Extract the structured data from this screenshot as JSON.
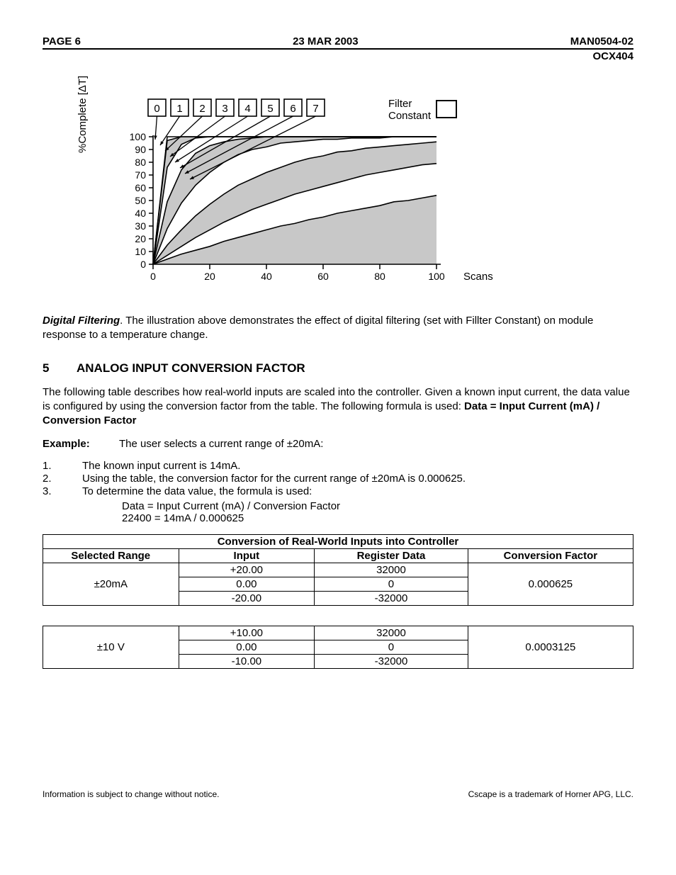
{
  "header": {
    "left": "PAGE 6",
    "center": "23 MAR 2003",
    "right": "MAN0504-02",
    "sub": "OCX404"
  },
  "chart_data": {
    "type": "line",
    "title": "",
    "xlabel": "Scans",
    "ylabel": "%Complete [ΔT]",
    "xlim": [
      0,
      100
    ],
    "ylim": [
      0,
      100
    ],
    "x_ticks": [
      0,
      20,
      40,
      60,
      80,
      100
    ],
    "y_ticks": [
      0,
      10,
      20,
      30,
      40,
      50,
      60,
      70,
      80,
      90,
      100
    ],
    "series_box_labels": [
      "0",
      "1",
      "2",
      "3",
      "4",
      "5",
      "6",
      "7"
    ],
    "legend_label": "Filter Constant",
    "x": [
      0,
      5,
      10,
      15,
      20,
      25,
      30,
      35,
      40,
      45,
      50,
      55,
      60,
      65,
      70,
      75,
      80,
      85,
      90,
      95,
      100
    ],
    "series": [
      {
        "name": "0",
        "values": [
          0,
          100,
          100,
          100,
          100,
          100,
          100,
          100,
          100,
          100,
          100,
          100,
          100,
          100,
          100,
          100,
          100,
          100,
          100,
          100,
          100
        ]
      },
      {
        "name": "1",
        "values": [
          0,
          97,
          100,
          100,
          100,
          100,
          100,
          100,
          100,
          100,
          100,
          100,
          100,
          100,
          100,
          100,
          100,
          100,
          100,
          100,
          100
        ]
      },
      {
        "name": "2",
        "values": [
          0,
          76,
          94,
          99,
          100,
          100,
          100,
          100,
          100,
          100,
          100,
          100,
          100,
          100,
          100,
          100,
          100,
          100,
          100,
          100,
          100
        ]
      },
      {
        "name": "3",
        "values": [
          0,
          49,
          74,
          87,
          93,
          96,
          98,
          99,
          100,
          100,
          100,
          100,
          100,
          100,
          100,
          100,
          100,
          100,
          100,
          100,
          100
        ]
      },
      {
        "name": "4",
        "values": [
          0,
          28,
          48,
          62,
          72,
          80,
          86,
          90,
          92,
          95,
          96,
          97,
          98,
          98,
          99,
          99,
          99,
          100,
          100,
          100,
          100
        ]
      },
      {
        "name": "5",
        "values": [
          0,
          15,
          27,
          38,
          47,
          55,
          62,
          67,
          72,
          76,
          80,
          83,
          85,
          88,
          89,
          91,
          92,
          93,
          94,
          95,
          96
        ]
      },
      {
        "name": "6",
        "values": [
          0,
          7,
          14,
          21,
          27,
          33,
          38,
          43,
          47,
          51,
          55,
          58,
          61,
          64,
          67,
          70,
          72,
          74,
          76,
          78,
          79
        ]
      },
      {
        "name": "7",
        "values": [
          0,
          4,
          8,
          11,
          14,
          18,
          21,
          24,
          27,
          30,
          32,
          35,
          37,
          40,
          42,
          44,
          46,
          49,
          50,
          52,
          54
        ]
      }
    ]
  },
  "para_filter_prefix": "Digital Filtering",
  "para_filter": ".  The illustration above demonstrates the effect of digital filtering (set with Fillter Constant) on module response to a temperature change.",
  "section": {
    "num": "5",
    "title": "ANALOG INPUT CONVERSION FACTOR"
  },
  "para_intro": "The following table describes how real-world inputs are scaled into the controller.  Given a known input current, the data value is configured by using the conversion factor from the table.  The following formula is used:  ",
  "formula_bold": "Data = Input Current (mA)  /  Conversion Factor",
  "example": {
    "label": "Example:",
    "text": "The user selects a current range of ±20mA:"
  },
  "steps": [
    "The known input current is 14mA.",
    "Using the table, the conversion factor for the current range of ±20mA is 0.000625.",
    "To determine the data value, the formula is used:"
  ],
  "step_indent": [
    "Data = Input Current (mA) / Conversion Factor",
    "22400 = 14mA / 0.000625"
  ],
  "table": {
    "title": "Conversion of Real-World Inputs into Controller",
    "headers": [
      "Selected Range",
      "Input",
      "Register Data",
      "Conversion Factor"
    ],
    "groups": [
      {
        "range": "±20mA",
        "factor": "0.000625",
        "rows": [
          {
            "input": "+20.00",
            "reg": "32000"
          },
          {
            "input": "0.00",
            "reg": "0"
          },
          {
            "input": "-20.00",
            "reg": "-32000"
          }
        ]
      },
      {
        "range": "±10 V",
        "factor": "0.0003125",
        "rows": [
          {
            "input": "+10.00",
            "reg": "32000"
          },
          {
            "input": "0.00",
            "reg": "0"
          },
          {
            "input": "-10.00",
            "reg": "-32000"
          }
        ]
      }
    ]
  },
  "footer": {
    "left": "Information is subject to change without notice.",
    "right": "Cscape is a trademark of Horner APG, LLC."
  }
}
